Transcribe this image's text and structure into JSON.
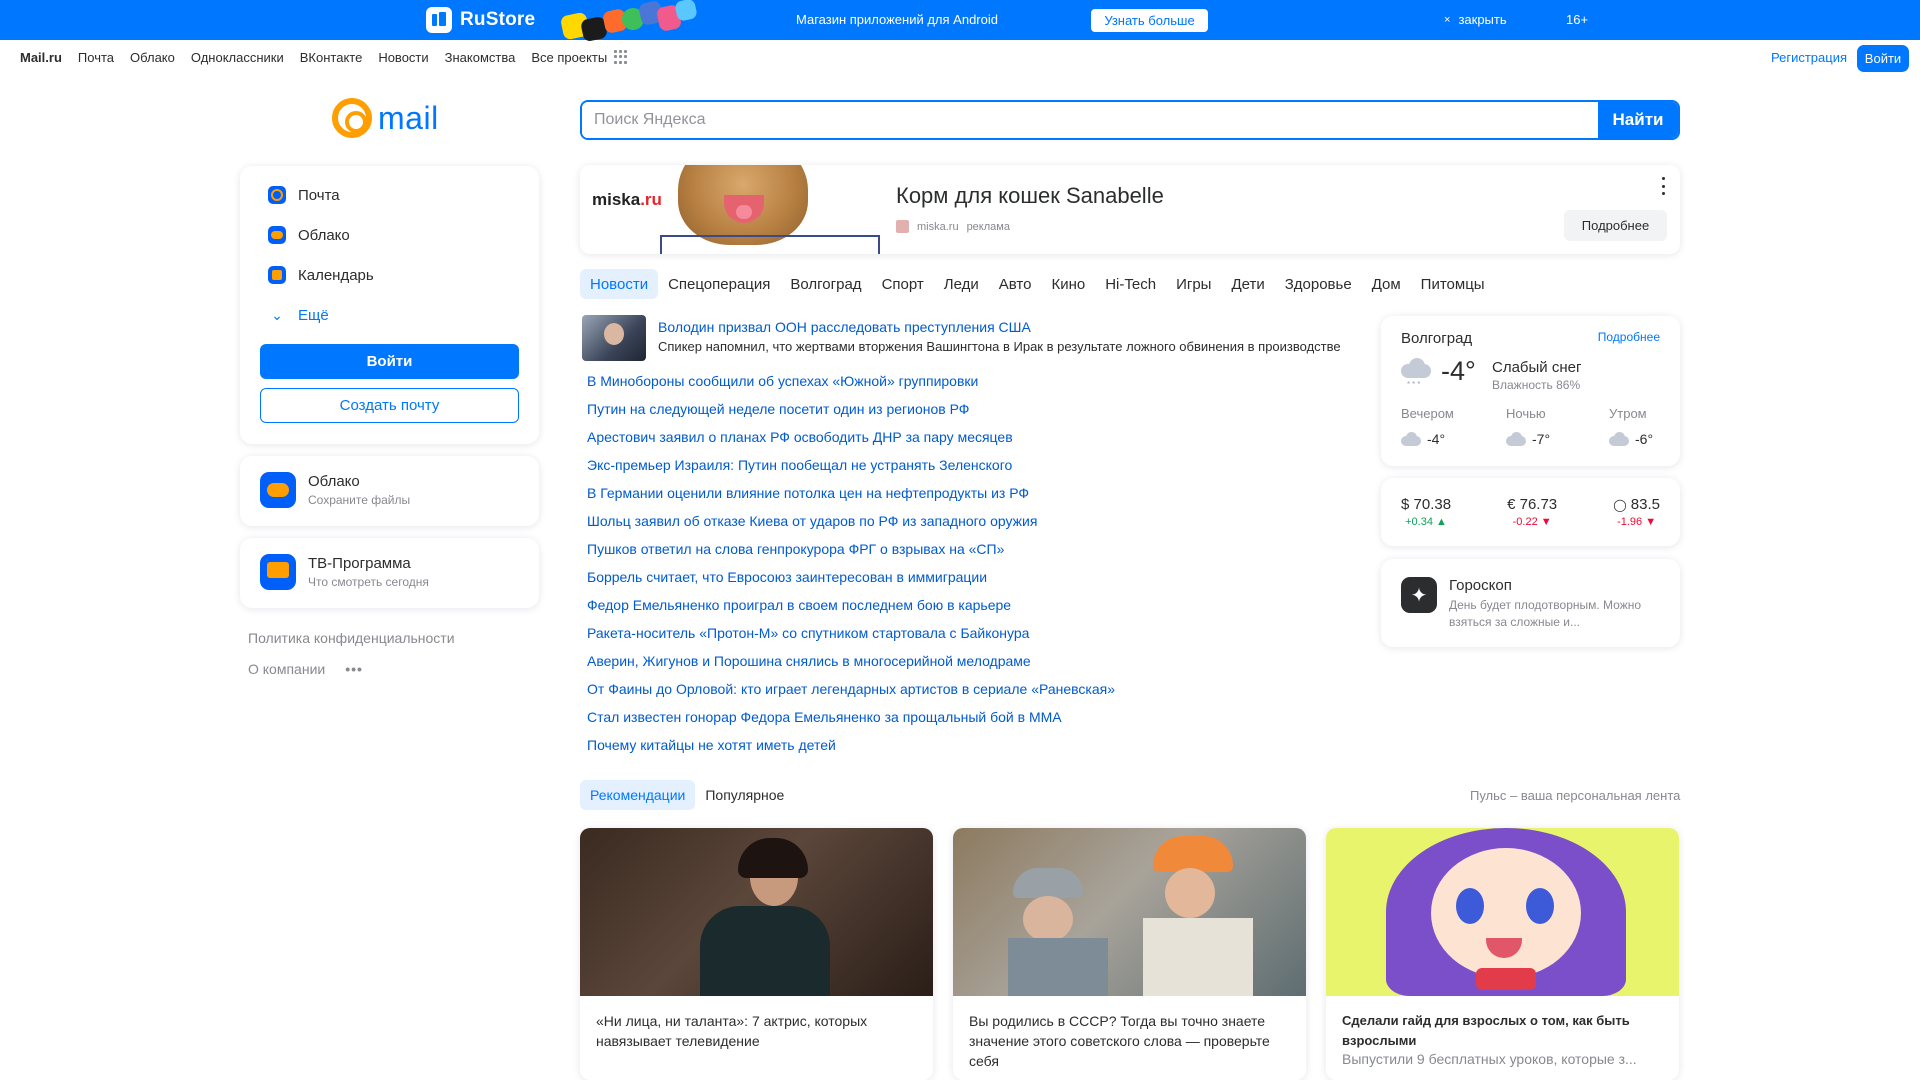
{
  "promo": {
    "brand": "RuStore",
    "message": "Магазин приложений для Android",
    "learn_more": "Узнать больше",
    "close_icon": "close-icon",
    "close_label": "закрыть",
    "age": "16+"
  },
  "topnav": {
    "links": [
      "Mail.ru",
      "Почта",
      "Облако",
      "Одноклассники",
      "ВКонтакте",
      "Новости",
      "Знакомства",
      "Все проекты"
    ],
    "register": "Регистрация",
    "login": "Войти"
  },
  "logo": {
    "text": "mail"
  },
  "search": {
    "placeholder": "Поиск Яндекса",
    "button": "Найти"
  },
  "services": {
    "items": [
      {
        "label": "Почта",
        "icon": "mail-icon"
      },
      {
        "label": "Облако",
        "icon": "cloud-icon"
      },
      {
        "label": "Календарь",
        "icon": "calendar-icon"
      },
      {
        "label": "Ещё",
        "icon": "chevron-down-icon"
      }
    ],
    "login_button": "Войти",
    "create_button": "Создать почту"
  },
  "cloud_card": {
    "title": "Облако",
    "subtitle": "Сохраните файлы"
  },
  "tv_card": {
    "title": "ТВ-Программа",
    "subtitle": "Что смотреть сегодня"
  },
  "footer_links": {
    "privacy": "Политика конфиденциальности",
    "about": "О компании",
    "more": "•••"
  },
  "ad": {
    "title": "Корм для кошек Sanabelle",
    "source": "miska.ru",
    "tag": "реклама",
    "more": "Подробнее",
    "logo_text": "miska",
    "logo_suffix": ".ru"
  },
  "news_tabs": [
    "Новости",
    "Спецоперация",
    "Волгоград",
    "Спорт",
    "Леди",
    "Авто",
    "Кино",
    "Hi-Tech",
    "Игры",
    "Дети",
    "Здоровье",
    "Дом",
    "Питомцы"
  ],
  "news": {
    "lead": {
      "headline": "Володин призвал ООН расследовать преступления США",
      "summary": "Спикер напомнил, что жертвами вторжения Вашингтона в Ирак в результате ложного обвинения в производстве"
    },
    "items": [
      "В Минобороны сообщили об успехах «Южной» группировки",
      "Путин на следующей неделе посетит один из регионов РФ",
      "Арестович заявил о планах РФ освободить ДНР за пару месяцев",
      "Экс-премьер Израиля: Путин пообещал не устранять Зеленского",
      "В Германии оценили влияние потолка цен на нефтепродукты из РФ",
      "Шольц заявил об отказе Киева от ударов по РФ из западного оружия",
      "Пушков ответил на слова генпрокурора ФРГ о взрывах на «СП»",
      "Боррель считает, что Евросоюз заинтересован в иммиграции",
      "Федор Емельяненко проиграл в своем последнем бою в карьере",
      "Ракета-носитель «Протон-М» со спутником стартовала с Байконура",
      "Аверин, Жигунов и Порошина снялись в многосерийной мелодраме",
      "От Фаины до Орловой: кто играет легендарных артистов в сериале «Раневская»",
      "Стал известен гонорар Федора Емельяненко за прощальный бой в ММА",
      "Почему китайцы не хотят иметь детей"
    ]
  },
  "weather": {
    "city": "Волгоград",
    "more": "Подробнее",
    "temp": "-4°",
    "condition": "Слабый снег",
    "humidity": "Влажность 86%",
    "parts": [
      {
        "label": "Вечером",
        "temp": "-4°"
      },
      {
        "label": "Ночью",
        "temp": "-7°"
      },
      {
        "label": "Утром",
        "temp": "-6°"
      }
    ]
  },
  "rates": [
    {
      "symbol": "$",
      "value": "70.38",
      "delta": "+0.34",
      "dir": "▲",
      "color": "#0da35a"
    },
    {
      "symbol": "€",
      "value": "76.73",
      "delta": "-0.22",
      "dir": "▼",
      "color": "#ed0a34"
    },
    {
      "symbol": "💧",
      "value": "83.5",
      "delta": "-1.96",
      "dir": "▼",
      "color": "#ed0a34"
    }
  ],
  "horoscope": {
    "title": "Гороскоп",
    "text": "День будет плодотворным. Можно взяться за сложные и..."
  },
  "feed_tabs": [
    "Рекомендации",
    "Популярное"
  ],
  "pulse": "Пульс – ваша персональная лента",
  "feed_cards": [
    {
      "caption": "«Ни лица, ни таланта»: 7 актрис, которых навязывает телевидение",
      "sub": ""
    },
    {
      "caption": "Вы родились в СССР? Тогда вы точно знаете значение этого советского слова — проверьте себя",
      "sub": ""
    },
    {
      "caption": "Сделали гайд для взрослых о том, как быть взрослыми",
      "sub": "Выпустили 9 бесплатных уроков, которые з..."
    }
  ],
  "colors": {
    "accent": "#0077ff",
    "link": "#005bd1",
    "logo_orange": "#ff9e00"
  }
}
